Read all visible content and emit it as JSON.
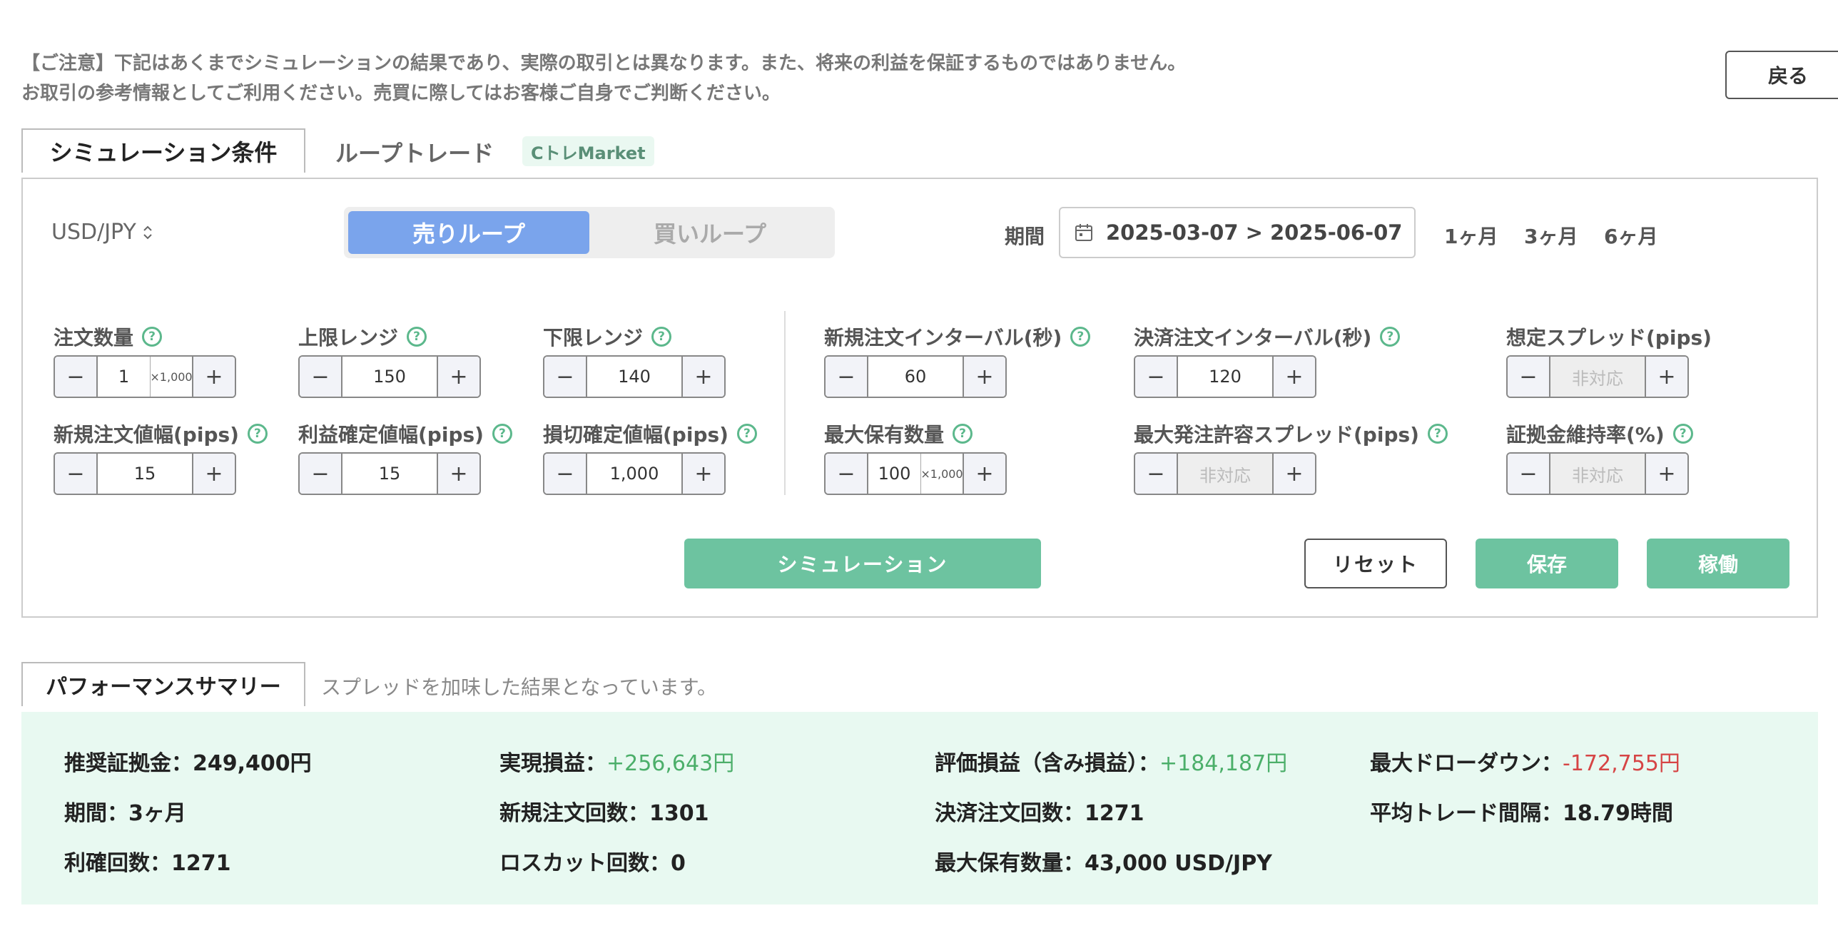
{
  "notice": {
    "line1": "【ご注意】下記はあくまでシミュレーションの結果であり、実際の取引とは異なります。また、将来の利益を保証するものではありません。",
    "line2": "お取引の参考情報としてご利用ください。売買に際してはお客様ご自身でご判断ください。"
  },
  "back_label": "戻る",
  "tabs": {
    "active": "シミュレーション条件",
    "loop": "ループトレード",
    "badge": "CトレMarket"
  },
  "pair": {
    "value": "USD/JPY",
    "icon": "updown-chevron-icon"
  },
  "direction": {
    "sell": "売りループ",
    "buy": "買いループ",
    "selected": "sell"
  },
  "period": {
    "label": "期間",
    "range": "2025-03-07 > 2025-06-07",
    "quick": [
      "1ヶ月",
      "3ヶ月",
      "6ヶ月"
    ]
  },
  "fields": {
    "order_qty": {
      "label": "注文数量",
      "value": "1",
      "unit": "×1,000"
    },
    "upper_range": {
      "label": "上限レンジ",
      "value": "150"
    },
    "lower_range": {
      "label": "下限レンジ",
      "value": "140"
    },
    "new_interval": {
      "label": "新規注文インターバル(秒)",
      "value": "60"
    },
    "settle_interval": {
      "label": "決済注文インターバル(秒)",
      "value": "120"
    },
    "assumed_spread": {
      "label": "想定スプレッド(pips)",
      "value": "非対応"
    },
    "new_width": {
      "label": "新規注文値幅(pips)",
      "value": "15"
    },
    "profit_width": {
      "label": "利益確定値幅(pips)",
      "value": "15"
    },
    "loss_width": {
      "label": "損切確定値幅(pips)",
      "value": "1,000"
    },
    "max_hold": {
      "label": "最大保有数量",
      "value": "100",
      "unit": "×1,000"
    },
    "max_spread": {
      "label": "最大発注許容スプレッド(pips)",
      "value": "非対応"
    },
    "margin_rate": {
      "label": "証拠金維持率(%)",
      "value": "非対応"
    }
  },
  "help_glyph": "?",
  "minus_glyph": "−",
  "plus_glyph": "+",
  "actions": {
    "simulate": "シミュレーション",
    "reset": "リセット",
    "save": "保存",
    "run": "稼働"
  },
  "performance": {
    "tab": "パフォーマンスサマリー",
    "note": "スプレッドを加味した結果となっています。",
    "stats": {
      "margin": {
        "label": "推奨証拠金：",
        "value": "249,400円"
      },
      "realized": {
        "label": "実現損益：",
        "value": "+256,643円"
      },
      "unrealized": {
        "label": "評価損益（含み損益）：",
        "value": "+184,187円"
      },
      "drawdown": {
        "label": "最大ドローダウン：",
        "value": "-172,755円"
      },
      "period": {
        "label": "期間：",
        "value": "3ヶ月"
      },
      "new_orders": {
        "label": "新規注文回数：",
        "value": "1301"
      },
      "settle_orders": {
        "label": "決済注文回数：",
        "value": "1271"
      },
      "avg_interval": {
        "label": "平均トレード間隔：",
        "value": "18.79時間"
      },
      "take_profit": {
        "label": "利確回数：",
        "value": "1271"
      },
      "losscut": {
        "label": "ロスカット回数：",
        "value": "0"
      },
      "max_hold": {
        "label": "最大保有数量：",
        "value": "43,000 USD/JPY"
      }
    }
  },
  "colors": {
    "accent_green": "#6dc3a0",
    "sell_blue": "#7aa4ec",
    "positive": "#4caf6a",
    "negative": "#d64545",
    "summary_bg": "#e8f9f1"
  }
}
